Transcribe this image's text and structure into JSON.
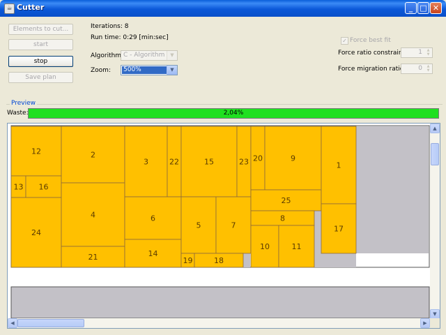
{
  "window": {
    "title": "Cutter"
  },
  "controls": {
    "elements_to_cut": "Elements to cut...",
    "start": "start",
    "stop": "stop",
    "save_plan": "Save plan"
  },
  "stats": {
    "iterations": "Iterations: 8",
    "run_time": "Run time: 0:29 [min:sec]"
  },
  "algorithm": {
    "label": "Algorithm:",
    "value": "C - Algorithm"
  },
  "zoom": {
    "label": "Zoom:",
    "value": "500%"
  },
  "options": {
    "force_best_fit": "Force best fit",
    "force_ratio_label": "Force ratio constraint:",
    "force_ratio_value": "1",
    "force_migration_label": "Force migration ratio:",
    "force_migration_value": "0"
  },
  "preview": {
    "group_title": "Preview",
    "waste_label": "Waste:",
    "waste_value": "2,04%",
    "waste_fill_fraction": 1.0
  },
  "pieces": [
    {
      "id": "piece-12",
      "label": "12"
    },
    {
      "id": "piece-13",
      "label": "13"
    },
    {
      "id": "piece-16",
      "label": "16"
    },
    {
      "id": "piece-24",
      "label": "24"
    },
    {
      "id": "piece-2",
      "label": "2"
    },
    {
      "id": "piece-4",
      "label": "4"
    },
    {
      "id": "piece-21",
      "label": "21"
    },
    {
      "id": "piece-3",
      "label": "3"
    },
    {
      "id": "piece-22",
      "label": "22"
    },
    {
      "id": "piece-6",
      "label": "6"
    },
    {
      "id": "piece-14",
      "label": "14"
    },
    {
      "id": "piece-15",
      "label": "15"
    },
    {
      "id": "piece-23",
      "label": "23"
    },
    {
      "id": "piece-5",
      "label": "5"
    },
    {
      "id": "piece-7",
      "label": "7"
    },
    {
      "id": "piece-19",
      "label": "19"
    },
    {
      "id": "piece-18",
      "label": "18"
    },
    {
      "id": "piece-20",
      "label": "20"
    },
    {
      "id": "piece-9",
      "label": "9"
    },
    {
      "id": "piece-25",
      "label": "25"
    },
    {
      "id": "piece-8",
      "label": "8"
    },
    {
      "id": "piece-10",
      "label": "10"
    },
    {
      "id": "piece-11",
      "label": "11"
    },
    {
      "id": "piece-1",
      "label": "1"
    },
    {
      "id": "piece-17",
      "label": "17"
    }
  ],
  "colors": {
    "piece_fill": "#FFC000",
    "piece_border": "#8E6A3A",
    "scrap": "#C3C1C7",
    "waste_bar": "#20E020"
  }
}
